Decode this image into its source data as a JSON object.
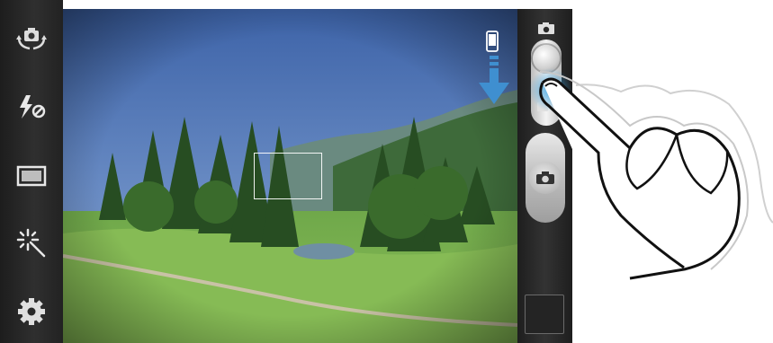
{
  "app": {
    "name": "Camera"
  },
  "left_toolbar": {
    "items": [
      {
        "icon": "switch-camera-icon"
      },
      {
        "icon": "flash-off-icon"
      },
      {
        "icon": "shooting-mode-icon"
      },
      {
        "icon": "effects-icon"
      },
      {
        "icon": "settings-icon"
      }
    ]
  },
  "right_panel": {
    "mode_switch": {
      "icons": [
        "camera-icon",
        "camcorder-icon"
      ],
      "selected": "camera"
    },
    "shutter_icon": "camera-icon",
    "gallery_thumbnail": "image-viewer-thumbnail"
  },
  "overlay": {
    "orientation_hint_icon": "phone-portrait-icon",
    "arrow": "down-arrow-icon",
    "gesture": "finger-swipe-down"
  },
  "colors": {
    "toolbar_bg": "#2a2a2a",
    "accent_arrow": "#3f8fd0",
    "sky": "#4a6fb0",
    "grass": "#7bb24a"
  }
}
